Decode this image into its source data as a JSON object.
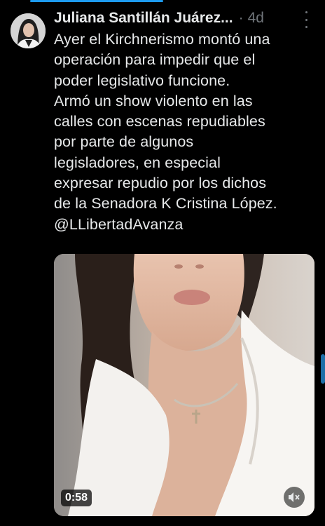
{
  "tweet": {
    "author_name": "Juliana Santillán Juárez...",
    "separator": "·",
    "time_ago": "4d",
    "text_lines": [
      "Ayer el Kirchnerismo montó una",
      "operación para impedir que el",
      "poder legislativo funcione.",
      "Armó un show violento en las",
      "calles con escenas repudiables",
      "por parte de algunos",
      "legisladores, en especial",
      "expresar  repudio por los dichos",
      "de la Senadora K Cristina López.",
      "@LLibertadAvanza"
    ]
  },
  "video": {
    "duration": "0:58",
    "progress_fraction": 0.41
  },
  "icons": {
    "more": "more-vertical-icon",
    "mute": "speaker-muted-icon"
  },
  "colors": {
    "background": "#000000",
    "text": "#e7e9ea",
    "secondary": "#71767b",
    "accent": "#1d9bf0"
  }
}
